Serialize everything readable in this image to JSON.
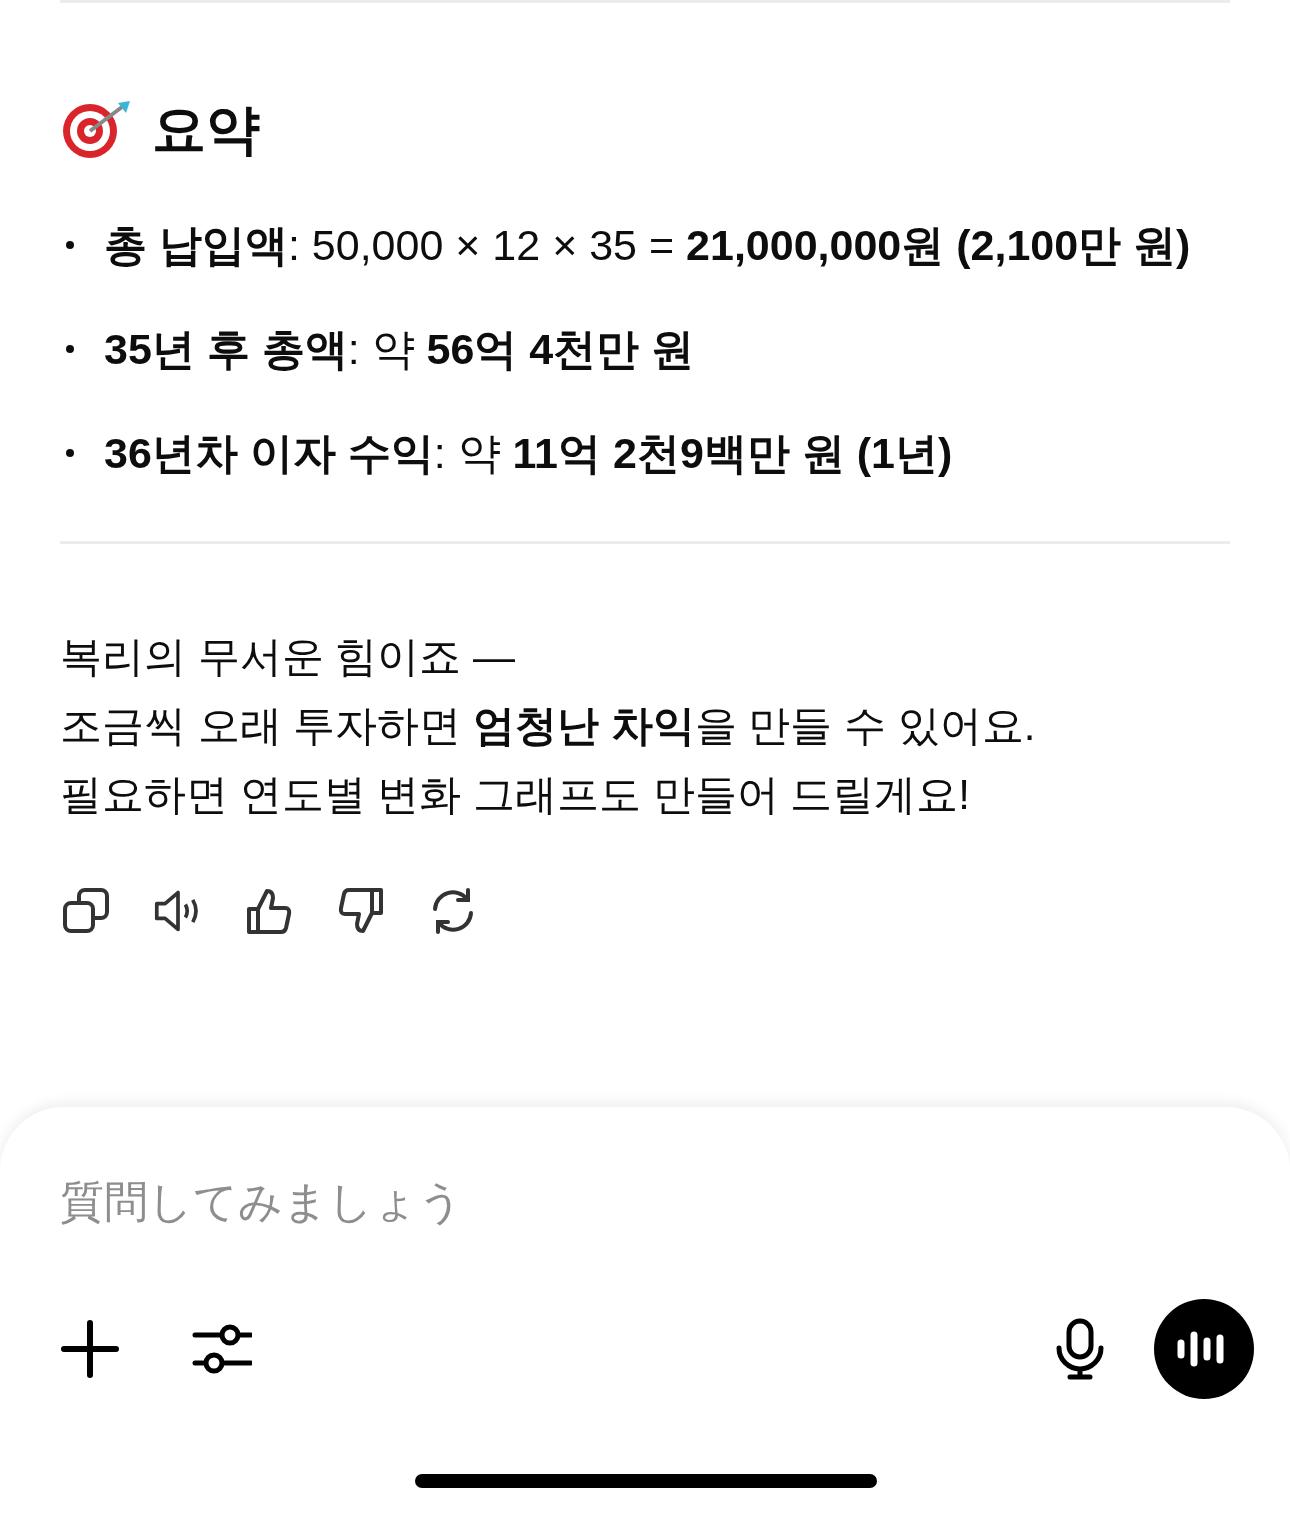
{
  "summary": {
    "title": "요약",
    "bullets": [
      "**총 납입액**: 50,000 × 12 × 35 = **21,000,000원 (2,100만 원)**",
      "**35년 후 총액**: 약 **56억 4천만 원**",
      "**36년차 이자 수익**: 약 **11억 2천9백만 원 (1년)**"
    ]
  },
  "closing": [
    "복리의 무서운 힘이죠 —",
    "조금씩 오래 투자하면 **엄청난 차익**을 만들 수 있어요.",
    "필요하면 연도별 변화 그래프도 만들어 드릴게요!"
  ],
  "composer": {
    "placeholder": "質問してみましょう"
  }
}
